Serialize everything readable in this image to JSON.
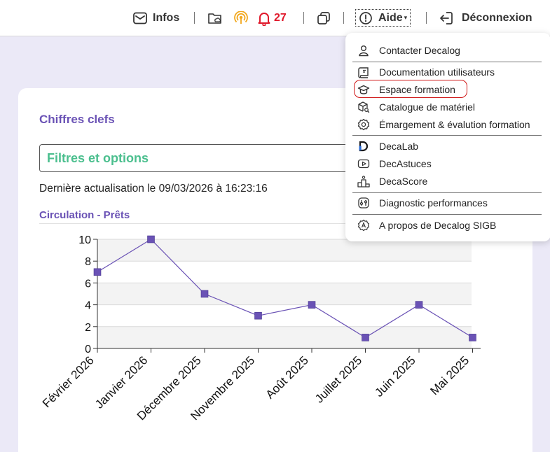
{
  "topbar": {
    "infos_label": "Infos",
    "notification_count": "27",
    "aide_label": "Aide",
    "logout_label": "Déconnexion"
  },
  "card": {
    "title": "Chiffres clefs",
    "filters_label": "Filtres et options",
    "last_update": "Dernière actualisation le 09/03/2026 à 16:23:16",
    "section_title": "Circulation - Prêts"
  },
  "help_menu": {
    "items": [
      {
        "label": "Contacter Decalog",
        "icon": "person-icon"
      },
      {
        "label": "Documentation utilisateurs",
        "icon": "book-icon"
      },
      {
        "label": "Espace formation",
        "icon": "graduation-cap-icon"
      },
      {
        "label": "Catalogue de matériel",
        "icon": "box-search-icon"
      },
      {
        "label": "Émargement & évalution formation",
        "icon": "gear-badge-icon"
      },
      {
        "label": "DecaLab",
        "icon": "decalab-logo-icon"
      },
      {
        "label": "DecAstuces",
        "icon": "video-play-icon"
      },
      {
        "label": "DecaScore",
        "icon": "podium-icon"
      },
      {
        "label": "Diagnostic performances",
        "icon": "diagnostic-icon"
      },
      {
        "label": "A propos de Decalog SIGB",
        "icon": "info-badge-icon"
      }
    ],
    "highlighted_item": "Espace formation"
  },
  "colors": {
    "accent_purple": "#6a52b5",
    "filters_green": "#4bbf8e",
    "alert_red": "#e0192b",
    "series_color": "#6a52b5"
  },
  "chart_data": {
    "type": "line",
    "categories": [
      "Février 2026",
      "Janvier 2026",
      "Décembre 2025",
      "Novembre 2025",
      "Août 2025",
      "Juillet 2025",
      "Juin 2025",
      "Mai 2025"
    ],
    "values": [
      7,
      10,
      5,
      3,
      4,
      1,
      4,
      1
    ],
    "ylim": [
      0,
      10
    ],
    "yticks": [
      "0",
      "2",
      "4",
      "6",
      "8",
      "10"
    ],
    "grid": true,
    "legend": "none"
  }
}
